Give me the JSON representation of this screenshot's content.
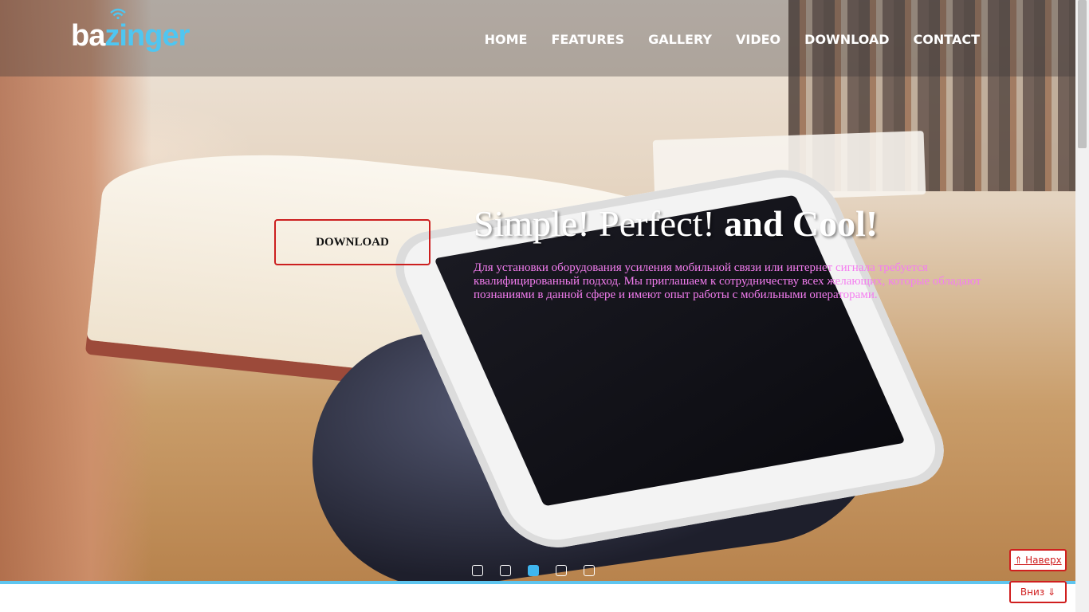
{
  "logo": {
    "part1": "ba",
    "part2": "zinger"
  },
  "nav": {
    "items": [
      {
        "label": "HOME"
      },
      {
        "label": "FEATURES"
      },
      {
        "label": "GALLERY"
      },
      {
        "label": "VIDEO"
      },
      {
        "label": "DOWNLOAD"
      },
      {
        "label": "CONTACT"
      }
    ]
  },
  "hero": {
    "download_label": "DOWNLOAD",
    "headline_normal": "Simple! Perfect! ",
    "headline_bold": "and Cool!",
    "description": "Для установки оборудования усиления мобильной связи или интернет сигнала требуется квалифицированный подход. Мы приглашаем к сотрудничеству всех желающих, которые обладают познаниями в данной сфере и имеют опыт работы с мобильными операторами.",
    "slides_total": 5,
    "active_slide": 3
  },
  "floating": {
    "up_label": "⇑ Наверх",
    "down_label": "Вниз ⇓"
  },
  "colors": {
    "accent": "#4fc6f1",
    "button_border": "#cc1f1f",
    "description_text": "#f47df0"
  }
}
